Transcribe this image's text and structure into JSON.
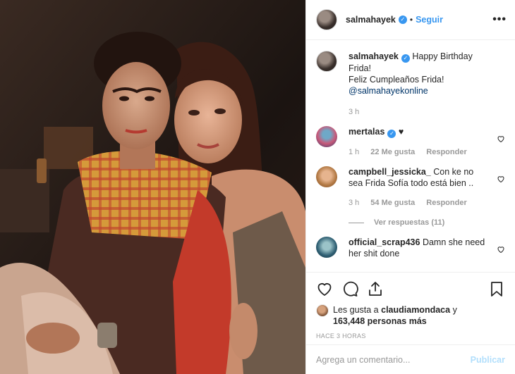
{
  "header": {
    "username": "salmahayek",
    "separator": "•",
    "follow_label": "Seguir",
    "more_label": "•••"
  },
  "caption": {
    "username": "salmahayek",
    "text_line1": "Happy Birthday Frida!",
    "text_line2": "Feliz Cumpleaños Frida!",
    "mention": "@salmahayekonline",
    "time": "3 h"
  },
  "comments": [
    {
      "username": "mertalas",
      "text": "♥",
      "time": "1 h",
      "likes": "22 Me gusta",
      "reply": "Responder"
    },
    {
      "username": "campbell_jessicka_",
      "text": "Con ke no sea Frida Sofía todo está bien ..",
      "time": "3 h",
      "likes": "54 Me gusta",
      "reply": "Responder",
      "view_replies": "Ver respuestas (11)"
    },
    {
      "username": "official_scrap436",
      "text": "Damn she need her shit done"
    }
  ],
  "likes": {
    "prefix": "Les gusta a",
    "user": "claudiamondaca",
    "joiner": "y",
    "count": "163,448 personas más"
  },
  "post_time": "HACE 3 HORAS",
  "add_comment": {
    "placeholder": "Agrega un comentario...",
    "publish_label": "Publicar"
  },
  "icons": {
    "like": "heart-icon",
    "comment": "comment-icon",
    "share": "share-icon",
    "save": "bookmark-icon"
  },
  "colors": {
    "accent_blue": "#3897f0",
    "link": "#003569",
    "muted": "#999999",
    "border": "#efefef"
  }
}
